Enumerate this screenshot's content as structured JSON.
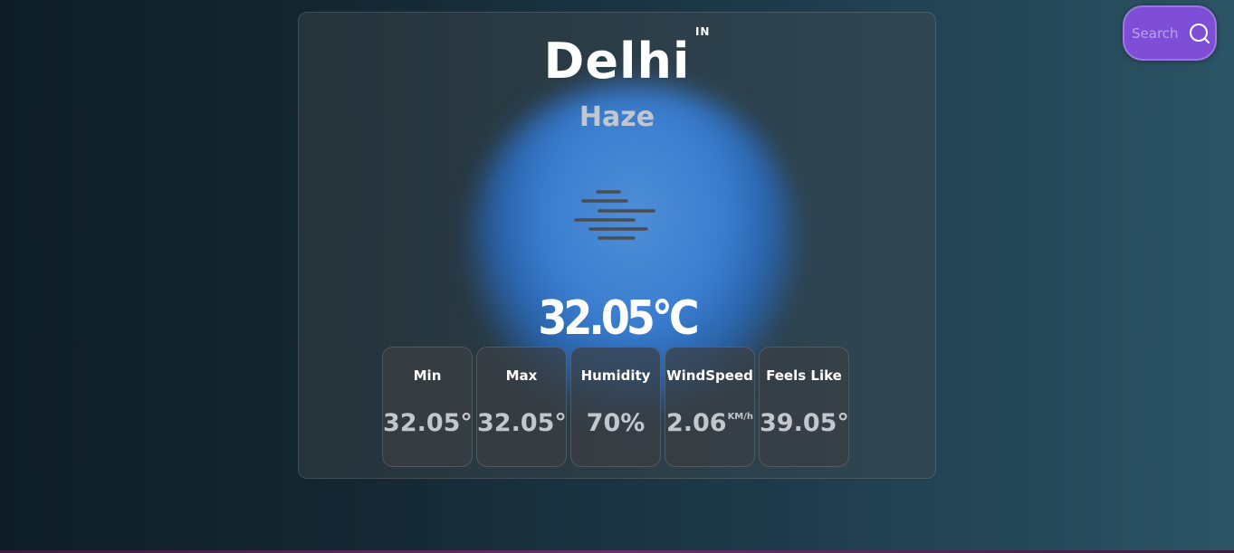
{
  "search": {
    "placeholder": "Search",
    "icon": "search-icon"
  },
  "weather": {
    "city": "Delhi",
    "country": "IN",
    "condition": "Haze",
    "condition_icon": "haze-icon",
    "temperature": "32.05°C"
  },
  "stats": [
    {
      "label": "Min",
      "value": "32.05°",
      "unit": ""
    },
    {
      "label": "Max",
      "value": "32.05°",
      "unit": ""
    },
    {
      "label": "Humidity",
      "value": "70%",
      "unit": ""
    },
    {
      "label": "WindSpeed",
      "value": "2.06",
      "unit": "KM/h"
    },
    {
      "label": "Feels Like",
      "value": "39.05°",
      "unit": ""
    }
  ],
  "colors": {
    "search_button": "#7e4fd6",
    "glow": "#3a7dd0",
    "card_bg": "#3f4448"
  }
}
